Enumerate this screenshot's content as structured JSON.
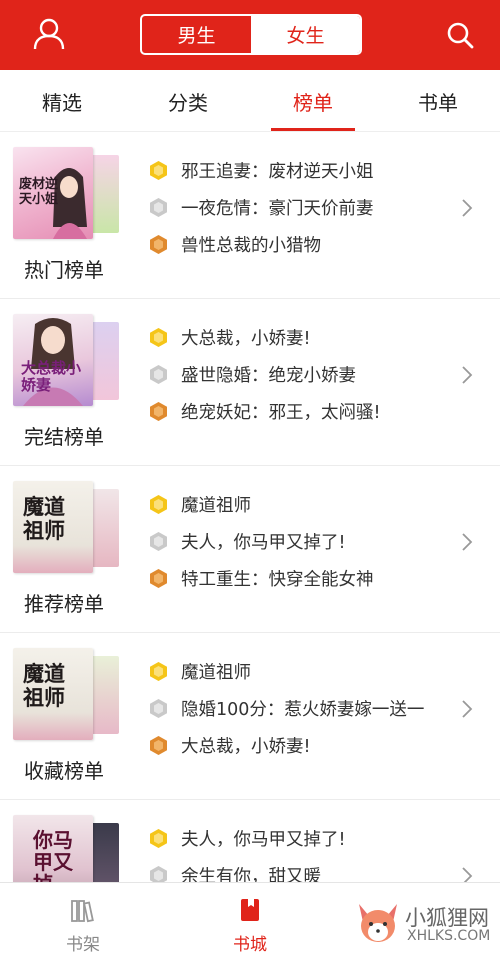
{
  "header": {
    "gender_tabs": [
      {
        "label": "男生"
      },
      {
        "label": "女生"
      }
    ],
    "active_gender": "女生",
    "user_icon": "user-icon",
    "search_icon": "search-icon"
  },
  "tabs": [
    {
      "label": "精选"
    },
    {
      "label": "分类"
    },
    {
      "label": "榜单"
    },
    {
      "label": "书单"
    }
  ],
  "active_tab": "榜单",
  "sections": [
    {
      "title": "热门榜单",
      "cover_text": "废材逆天小姐",
      "items": [
        {
          "rank": 1,
          "text": "邪王追妻：废材逆天小姐"
        },
        {
          "rank": 2,
          "text": "一夜危情：豪门天价前妻"
        },
        {
          "rank": 3,
          "text": "兽性总裁的小猎物"
        }
      ]
    },
    {
      "title": "完结榜单",
      "cover_text": "大总裁小娇妻",
      "items": [
        {
          "rank": 1,
          "text": "大总裁，小娇妻!"
        },
        {
          "rank": 2,
          "text": "盛世隐婚：绝宠小娇妻"
        },
        {
          "rank": 3,
          "text": "绝宠妖妃：邪王，太闷骚!"
        }
      ]
    },
    {
      "title": "推荐榜单",
      "cover_text": "魔道祖师",
      "items": [
        {
          "rank": 1,
          "text": "魔道祖师"
        },
        {
          "rank": 2,
          "text": "夫人，你马甲又掉了!"
        },
        {
          "rank": 3,
          "text": "特工重生：快穿全能女神"
        }
      ]
    },
    {
      "title": "收藏榜单",
      "cover_text": "魔道祖师",
      "items": [
        {
          "rank": 1,
          "text": "魔道祖师"
        },
        {
          "rank": 2,
          "text": "隐婚100分：惹火娇妻嫁一送一"
        },
        {
          "rank": 3,
          "text": "大总裁，小娇妻!"
        }
      ]
    },
    {
      "title": "",
      "cover_text": "你马甲又掉",
      "items": [
        {
          "rank": 1,
          "text": "夫人，你马甲又掉了!"
        },
        {
          "rank": 2,
          "text": "余生有你，甜又暖"
        }
      ]
    }
  ],
  "bottom_nav": [
    {
      "label": "书架",
      "icon": "bookshelf-icon"
    },
    {
      "label": "书城",
      "icon": "bookstore-icon"
    }
  ],
  "active_nav": "书城",
  "watermark": {
    "text": "小狐狸网",
    "url": "XHLKS.COM"
  },
  "colors": {
    "brand_red": "#e0241a",
    "gold_medal": "#f5c518",
    "silver_medal": "#c9c9c9",
    "bronze_medal": "#e08a2e"
  }
}
